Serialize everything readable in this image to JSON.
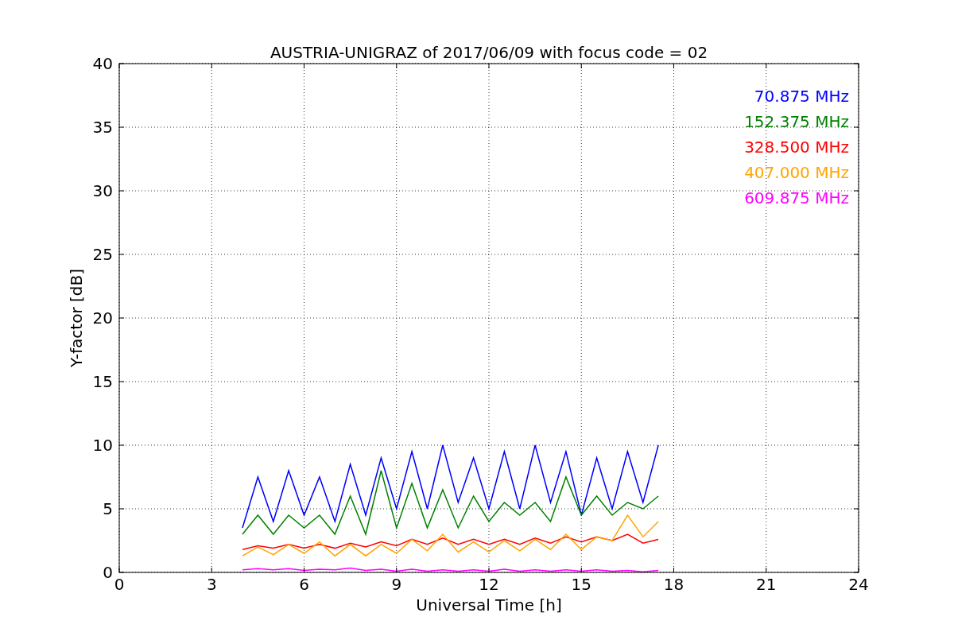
{
  "figure": {
    "chart_data": {
      "type": "line",
      "title": "AUSTRIA-UNIGRAZ of 2017/06/09 with focus code = 02",
      "xlabel": "Universal Time [h]",
      "ylabel": "Y-factor [dB]",
      "xlim": [
        0,
        24
      ],
      "ylim": [
        0,
        40
      ],
      "grid": true,
      "xticks": [
        0,
        3,
        6,
        9,
        12,
        15,
        18,
        21,
        24
      ],
      "yticks": [
        0,
        5,
        10,
        15,
        20,
        25,
        30,
        35,
        40
      ],
      "x": [
        4,
        4.5,
        5,
        5.5,
        6,
        6.5,
        7,
        7.5,
        8,
        8.5,
        9,
        9.5,
        10,
        10.5,
        11,
        11.5,
        12,
        12.5,
        13,
        13.5,
        14,
        14.5,
        15,
        15.5,
        16,
        16.5,
        17,
        17.5
      ],
      "series": [
        {
          "name": "70.875 MHz",
          "color": "#0000ff",
          "values": [
            3.5,
            7.5,
            4,
            8,
            4.5,
            7.5,
            4,
            8.5,
            4.5,
            9,
            5,
            9.5,
            5,
            10,
            5.5,
            9,
            5,
            9.5,
            5,
            10,
            5.5,
            9.5,
            4.5,
            9,
            5,
            9.5,
            5.5,
            10
          ]
        },
        {
          "name": "152.375 MHz",
          "color": "#008000",
          "values": [
            3,
            4.5,
            3,
            4.5,
            3.5,
            4.5,
            3,
            6,
            3,
            8,
            3.5,
            7,
            3.5,
            6.5,
            3.5,
            6,
            4,
            5.5,
            4.5,
            5.5,
            4,
            7.5,
            4.5,
            6,
            4.5,
            5.5,
            5,
            6
          ]
        },
        {
          "name": "328.500 MHz",
          "color": "#ff0000",
          "values": [
            1.8,
            2.1,
            1.9,
            2.2,
            1.9,
            2.2,
            1.9,
            2.3,
            2,
            2.4,
            2.1,
            2.6,
            2.2,
            2.7,
            2.2,
            2.6,
            2.2,
            2.6,
            2.2,
            2.7,
            2.3,
            2.8,
            2.4,
            2.8,
            2.5,
            3,
            2.3,
            2.6
          ]
        },
        {
          "name": "407.000 MHz",
          "color": "#ffa500",
          "values": [
            1.3,
            2,
            1.4,
            2.2,
            1.5,
            2.4,
            1.3,
            2.2,
            1.3,
            2.2,
            1.5,
            2.6,
            1.7,
            3,
            1.6,
            2.4,
            1.6,
            2.5,
            1.7,
            2.6,
            1.8,
            3,
            1.8,
            2.8,
            2.5,
            4.5,
            2.8,
            4
          ]
        },
        {
          "name": "609.875 MHz",
          "color": "#ff00ff",
          "values": [
            0.2,
            0.3,
            0.2,
            0.3,
            0.15,
            0.25,
            0.2,
            0.35,
            0.15,
            0.25,
            0.1,
            0.25,
            0.1,
            0.2,
            0.1,
            0.2,
            0.1,
            0.25,
            0.1,
            0.2,
            0.1,
            0.2,
            0.1,
            0.2,
            0.1,
            0.15,
            0.05,
            0.15
          ]
        }
      ]
    }
  }
}
